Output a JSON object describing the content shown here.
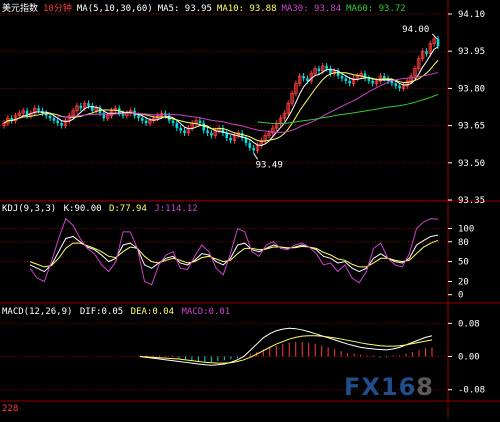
{
  "header": {
    "instrument": "美元指数",
    "period": "10分钟",
    "ma_label": "MA(5,10,30,60)",
    "ma5": "MA5: 93.95",
    "ma10": "MA10: 93.88",
    "ma30": "MA30: 93.84",
    "ma60": "MA60: 93.72"
  },
  "kdj": {
    "label": "KDJ(9,3,3)",
    "k": "K:90.00",
    "d": "D:77.94",
    "j": "J:114.12"
  },
  "macd": {
    "label": "MACD(12,26,9)",
    "dif": "DIF:0.05",
    "dea": "DEA:0.04",
    "macd": "MACD:0.01"
  },
  "annotations": {
    "high": "94.00",
    "low": "93.49"
  },
  "watermark": {
    "a": "FX16",
    "b": "8"
  },
  "footer": "228",
  "colors": {
    "up": "#ff3c3c",
    "down": "#00e0e0",
    "ma5": "#ffffff",
    "ma10": "#ffff66",
    "ma30": "#cc44cc",
    "ma60": "#33cc33",
    "grid": "#8b0000"
  },
  "chart_data": [
    {
      "type": "candlestick",
      "ylim": [
        93.35,
        94.1
      ],
      "y_ticks": [
        "94.10",
        "93.95",
        "93.80",
        "93.65",
        "93.50",
        "93.35"
      ],
      "y_tick_values": [
        94.1,
        93.95,
        93.8,
        93.65,
        93.5,
        93.35
      ],
      "closes": [
        93.66,
        93.68,
        93.67,
        93.69,
        93.7,
        93.71,
        93.69,
        93.7,
        93.72,
        93.71,
        93.7,
        93.69,
        93.68,
        93.67,
        93.66,
        93.65,
        93.67,
        93.69,
        93.71,
        93.73,
        93.72,
        93.74,
        93.73,
        93.71,
        93.72,
        93.7,
        93.68,
        93.69,
        93.71,
        93.72,
        93.7,
        93.69,
        93.7,
        93.71,
        93.69,
        93.68,
        93.67,
        93.66,
        93.67,
        93.68,
        93.69,
        93.7,
        93.69,
        93.67,
        93.66,
        93.64,
        93.63,
        93.62,
        93.64,
        93.66,
        93.67,
        93.66,
        93.63,
        93.62,
        93.61,
        93.63,
        93.64,
        93.62,
        93.6,
        93.59,
        93.61,
        93.62,
        93.6,
        93.58,
        93.56,
        93.55,
        93.57,
        93.59,
        93.61,
        93.62,
        93.64,
        93.66,
        93.68,
        93.7,
        93.74,
        93.78,
        93.82,
        93.85,
        93.84,
        93.83,
        93.86,
        93.88,
        93.87,
        93.89,
        93.88,
        93.86,
        93.87,
        93.85,
        93.84,
        93.83,
        93.82,
        93.84,
        93.85,
        93.86,
        93.84,
        93.83,
        93.82,
        93.83,
        93.85,
        93.84,
        93.83,
        93.82,
        93.81,
        93.8,
        93.81,
        93.83,
        93.85,
        93.88,
        93.92,
        93.95,
        93.94,
        93.98,
        94.0,
        93.97
      ],
      "ma5_label": "MA5",
      "ma10_label": "MA10",
      "ma30_label": "MA30",
      "ma60_label": "MA60"
    },
    {
      "type": "line",
      "ylim": [
        -5,
        125
      ],
      "y_ticks": [
        "100",
        "80",
        "50",
        "20",
        "0"
      ],
      "y_tick_values": [
        100,
        80,
        50,
        20,
        0
      ],
      "series": [
        {
          "name": "K",
          "values": [
            45,
            40,
            35,
            45,
            65,
            85,
            88,
            80,
            72,
            68,
            60,
            50,
            55,
            75,
            78,
            70,
            45,
            40,
            48,
            55,
            58,
            48,
            45,
            52,
            62,
            60,
            50,
            45,
            55,
            75,
            78,
            68,
            65,
            70,
            75,
            72,
            70,
            72,
            75,
            72,
            68,
            58,
            55,
            48,
            50,
            40,
            35,
            40,
            55,
            62,
            55,
            50,
            48,
            55,
            75,
            82,
            88,
            90
          ]
        },
        {
          "name": "D",
          "values": [
            50,
            46,
            42,
            44,
            55,
            70,
            78,
            78,
            74,
            70,
            65,
            58,
            56,
            65,
            72,
            70,
            58,
            50,
            48,
            52,
            55,
            52,
            48,
            50,
            56,
            58,
            54,
            50,
            52,
            62,
            70,
            70,
            68,
            69,
            72,
            72,
            71,
            71,
            73,
            72,
            70,
            64,
            60,
            54,
            52,
            46,
            42,
            42,
            48,
            55,
            55,
            52,
            50,
            52,
            62,
            72,
            78,
            82
          ]
        },
        {
          "name": "J",
          "values": [
            40,
            25,
            20,
            50,
            85,
            115,
            105,
            85,
            70,
            62,
            45,
            35,
            50,
            95,
            95,
            70,
            20,
            15,
            45,
            60,
            65,
            40,
            38,
            58,
            75,
            65,
            40,
            30,
            62,
            100,
            95,
            65,
            58,
            75,
            80,
            70,
            68,
            75,
            78,
            72,
            62,
            45,
            48,
            35,
            45,
            25,
            18,
            35,
            70,
            78,
            55,
            45,
            42,
            62,
            100,
            110,
            115,
            114
          ]
        }
      ]
    },
    {
      "type": "bar",
      "ylim": [
        -0.1,
        0.1
      ],
      "y_ticks": [
        "0.08",
        "0.00",
        "-0.08"
      ],
      "y_tick_values": [
        0.08,
        0.0,
        -0.08
      ],
      "start_index": 22,
      "series": [
        {
          "name": "MACD",
          "values": [
            0.0,
            0.0,
            0.0,
            0.0,
            0.0,
            0.0,
            -0.002,
            -0.003,
            -0.004,
            -0.005,
            -0.006,
            -0.006,
            -0.005,
            -0.004,
            -0.003,
            -0.002,
            0.001,
            0.003,
            0.005,
            0.008,
            0.01,
            0.012,
            0.014,
            0.015,
            0.016,
            0.016,
            0.015,
            0.014,
            0.012,
            0.01,
            0.008,
            0.006,
            0.004,
            0.003,
            0.002,
            0.001,
            0.0,
            -0.001,
            -0.001,
            0.0,
            0.001,
            0.003,
            0.005,
            0.007,
            0.009,
            0.01
          ]
        },
        {
          "name": "DIF",
          "values": [
            0.0,
            -0.002,
            -0.004,
            -0.006,
            -0.008,
            -0.01,
            -0.012,
            -0.014,
            -0.016,
            -0.018,
            -0.02,
            -0.021,
            -0.02,
            -0.018,
            -0.014,
            -0.008,
            0.0,
            0.015,
            0.03,
            0.045,
            0.055,
            0.062,
            0.066,
            0.068,
            0.067,
            0.064,
            0.06,
            0.055,
            0.05,
            0.045,
            0.04,
            0.035,
            0.03,
            0.026,
            0.022,
            0.02,
            0.018,
            0.017,
            0.016,
            0.018,
            0.022,
            0.028,
            0.034,
            0.04,
            0.046,
            0.05
          ]
        },
        {
          "name": "DEA",
          "values": [
            0.0,
            -0.001,
            -0.002,
            -0.003,
            -0.004,
            -0.005,
            -0.006,
            -0.008,
            -0.01,
            -0.012,
            -0.014,
            -0.015,
            -0.016,
            -0.016,
            -0.015,
            -0.012,
            -0.008,
            -0.002,
            0.006,
            0.014,
            0.022,
            0.03,
            0.036,
            0.042,
            0.046,
            0.049,
            0.05,
            0.05,
            0.049,
            0.047,
            0.045,
            0.042,
            0.039,
            0.036,
            0.033,
            0.03,
            0.028,
            0.026,
            0.025,
            0.025,
            0.026,
            0.028,
            0.031,
            0.034,
            0.037,
            0.04
          ]
        }
      ]
    }
  ]
}
